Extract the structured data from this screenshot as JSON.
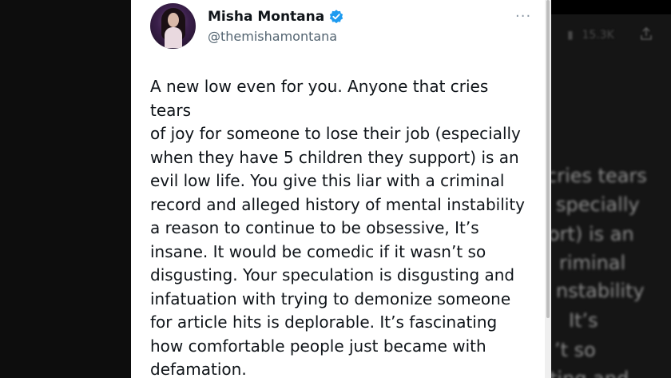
{
  "tweet": {
    "author_name": "Misha Montana",
    "author_handle": "@themishamontana",
    "more_label": "···",
    "text": "A new low even for you. Anyone that cries tears\nof joy for someone to lose their job (especially\nwhen they have 5 children they support) is an\nevil low life. You give this liar with a criminal\nrecord and alleged history of mental instability\na reason to continue to be obsessive, It’s\ninsane. It would be comedic if it wasn’t so\ndisgusting. Your speculation is disgusting and\ninfatuation with trying to demonize someone\nfor article hits is deplorable. It’s fascinating\nhow comfortable people just became with\ndefamation."
  },
  "background": {
    "views": "15.3K",
    "text_fragments": [
      "cries tears",
      "specially",
      "ort) is an",
      "riminal",
      "nstability",
      "It’s",
      "’t so",
      "ting and"
    ]
  },
  "colors": {
    "verified_blue": "#1d9bf0",
    "text_primary": "#0f1419",
    "text_secondary": "#536471"
  }
}
